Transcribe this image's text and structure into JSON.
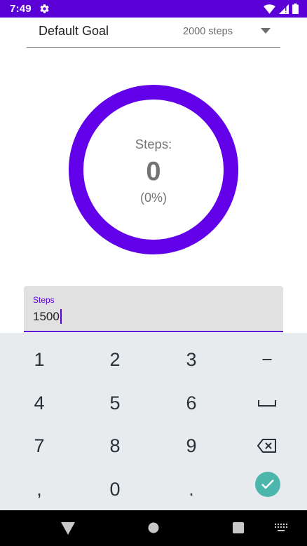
{
  "status_bar": {
    "time": "7:49",
    "background_color": "#5a00d6",
    "icons": [
      "gear-icon",
      "wifi-icon",
      "cell-signal-icon",
      "battery-icon"
    ]
  },
  "goal": {
    "label": "Default Goal",
    "selected_value": "2000 steps"
  },
  "progress": {
    "label": "Steps:",
    "count": "0",
    "percent_text": "(0%)",
    "ring_color": "#6200ea"
  },
  "steps_input": {
    "label": "Steps",
    "value": "1500",
    "accent_color": "#5a00d6"
  },
  "keypad": {
    "keys": [
      [
        "1",
        "2",
        "3",
        "−"
      ],
      [
        "4",
        "5",
        "6",
        "space"
      ],
      [
        "7",
        "8",
        "9",
        "backspace"
      ],
      [
        ",",
        "0",
        ".",
        "done"
      ]
    ],
    "done_color": "#4db6ac"
  },
  "nav_bar": {
    "buttons": [
      "back-icon",
      "home-icon",
      "recents-icon",
      "keyboard-icon"
    ]
  }
}
